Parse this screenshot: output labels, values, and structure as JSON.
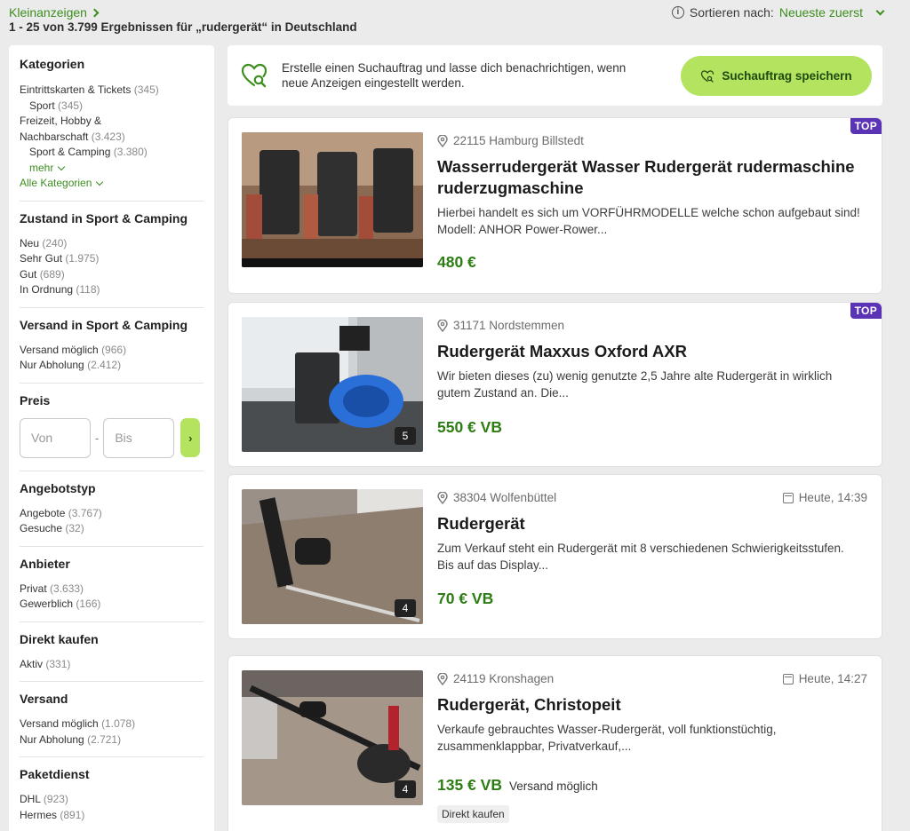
{
  "header": {
    "breadcrumb": "Kleinanzeigen",
    "results_summary": "1 - 25 von 3.799 Ergebnissen für „rudergerät“ in Deutschland",
    "sort_label": "Sortieren nach:",
    "sort_value": "Neueste zuerst"
  },
  "sidebar": {
    "categories": {
      "title": "Kategorien",
      "items": [
        {
          "label": "Eintrittskarten & Tickets",
          "count": "(345)"
        },
        {
          "label": "Sport",
          "count": "(345)"
        },
        {
          "label": "Freizeit, Hobby &",
          "count": ""
        },
        {
          "label": "Nachbarschaft",
          "count": "(3.423)"
        },
        {
          "label": "Sport & Camping",
          "count": "(3.380)"
        }
      ],
      "more": "mehr",
      "all": "Alle Kategorien"
    },
    "condition": {
      "title": "Zustand in Sport & Camping",
      "items": [
        {
          "label": "Neu",
          "count": "(240)"
        },
        {
          "label": "Sehr Gut",
          "count": "(1.975)"
        },
        {
          "label": "Gut",
          "count": "(689)"
        },
        {
          "label": "In Ordnung",
          "count": "(118)"
        }
      ]
    },
    "shipping_cat": {
      "title": "Versand in Sport & Camping",
      "items": [
        {
          "label": "Versand möglich",
          "count": "(966)"
        },
        {
          "label": "Nur Abholung",
          "count": "(2.412)"
        }
      ]
    },
    "price": {
      "title": "Preis",
      "from_placeholder": "Von",
      "to_placeholder": "Bis",
      "dash": "-",
      "go": "›"
    },
    "offer_type": {
      "title": "Angebotstyp",
      "items": [
        {
          "label": "Angebote",
          "count": "(3.767)"
        },
        {
          "label": "Gesuche",
          "count": "(32)"
        }
      ]
    },
    "provider": {
      "title": "Anbieter",
      "items": [
        {
          "label": "Privat",
          "count": "(3.633)"
        },
        {
          "label": "Gewerblich",
          "count": "(166)"
        }
      ]
    },
    "direct_buy": {
      "title": "Direkt kaufen",
      "items": [
        {
          "label": "Aktiv",
          "count": "(331)"
        }
      ]
    },
    "shipping": {
      "title": "Versand",
      "items": [
        {
          "label": "Versand möglich",
          "count": "(1.078)"
        },
        {
          "label": "Nur Abholung",
          "count": "(2.721)"
        }
      ]
    },
    "parcel": {
      "title": "Paketdienst",
      "items": [
        {
          "label": "DHL",
          "count": "(923)"
        },
        {
          "label": "Hermes",
          "count": "(891)"
        }
      ]
    }
  },
  "save_search": {
    "text": "Erstelle einen Suchauftrag und lasse dich benachrichtigen, wenn neue Anzeigen eingestellt werden.",
    "button": "Suchauftrag speichern"
  },
  "listings": [
    {
      "location": "22115 Hamburg Billstedt",
      "date": "",
      "title": "Wasserrudergerät Wasser Rudergerät rudermaschine ruderzugmaschine",
      "description": "Hierbei handelt es sich um VORFÜHRMODELLE welche schon aufgebaut sind! Modell: ANHOR Power-Rower...",
      "price": "480 €",
      "shipping": "",
      "badge": "TOP",
      "image_count": "",
      "direct_buy": ""
    },
    {
      "location": "31171 Nordstemmen",
      "date": "",
      "title": "Rudergerät Maxxus Oxford AXR",
      "description": "Wir bieten dieses (zu) wenig genutzte 2,5 Jahre alte Rudergerät in wirklich gutem Zustand an. Die...",
      "price": "550 € VB",
      "shipping": "",
      "badge": "TOP",
      "image_count": "5",
      "direct_buy": ""
    },
    {
      "location": "38304 Wolfenbüttel",
      "date": "Heute, 14:39",
      "title": "Rudergerät",
      "description": "Zum Verkauf steht ein Rudergerät mit 8 verschiedenen Schwierigkeitsstufen. Bis auf das Display...",
      "price": "70 € VB",
      "shipping": "",
      "badge": "",
      "image_count": "4",
      "direct_buy": ""
    },
    {
      "location": "24119 Kronshagen",
      "date": "Heute, 14:27",
      "title": "Rudergerät, Christopeit",
      "description": "Verkaufe gebrauchtes Wasser-Rudergerät, voll funktionstüchtig, zusammenklappbar, Privatverkauf,...",
      "price": "135 € VB",
      "shipping": "Versand möglich",
      "badge": "",
      "image_count": "4",
      "direct_buy": "Direkt kaufen"
    }
  ],
  "colors": {
    "accent_green": "#3d8e1f",
    "button_green": "#b3e35f",
    "price_green": "#2e7d14",
    "top_badge": "#5a34b5"
  },
  "icons": {
    "breadcrumb": "chevron-right-icon",
    "sort": "info-icon",
    "location": "location-pin-icon",
    "date": "calendar-icon",
    "save_search": "heart-search-icon"
  }
}
